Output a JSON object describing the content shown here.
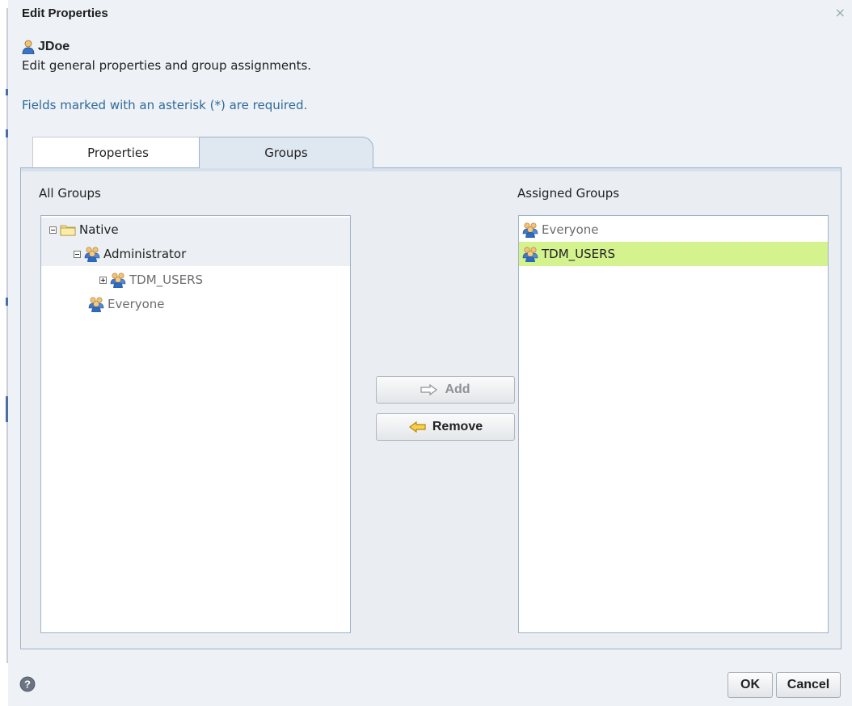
{
  "dialog": {
    "title": "Edit Properties",
    "close_glyph": "×",
    "user_name": "JDoe",
    "description": "Edit general properties and group assignments.",
    "required_note": "Fields marked with an asterisk (*) are required."
  },
  "tabs": [
    {
      "label": "Properties",
      "active": false
    },
    {
      "label": "Groups",
      "active": true
    }
  ],
  "all_groups": {
    "label": "All Groups",
    "tree": [
      {
        "label": "Native",
        "icon": "folder-icon",
        "toggle": "collapse",
        "level": 0
      },
      {
        "label": "Administrator",
        "icon": "group-icon",
        "toggle": "collapse",
        "level": 1
      },
      {
        "label": "TDM_USERS",
        "icon": "group-icon",
        "toggle": "expand",
        "level": 2,
        "dimmed": true
      },
      {
        "label": "Everyone",
        "icon": "group-icon",
        "level": 1,
        "dimmed": true
      }
    ]
  },
  "assigned_groups": {
    "label": "Assigned Groups",
    "items": [
      {
        "label": "Everyone",
        "icon": "group-icon",
        "dimmed": true,
        "selected": false
      },
      {
        "label": "TDM_USERS",
        "icon": "group-icon",
        "dimmed": false,
        "selected": true
      }
    ]
  },
  "actions": {
    "add_label": "Add",
    "add_enabled": false,
    "remove_label": "Remove",
    "remove_enabled": true
  },
  "footer": {
    "ok_label": "OK",
    "cancel_label": "Cancel",
    "help_icon": "help-icon"
  },
  "colors": {
    "selected_row": "#d4f28e",
    "link_text": "#2f6b9c",
    "panel_border": "#9fb2c8",
    "dialog_bg": "#eef1f5"
  }
}
